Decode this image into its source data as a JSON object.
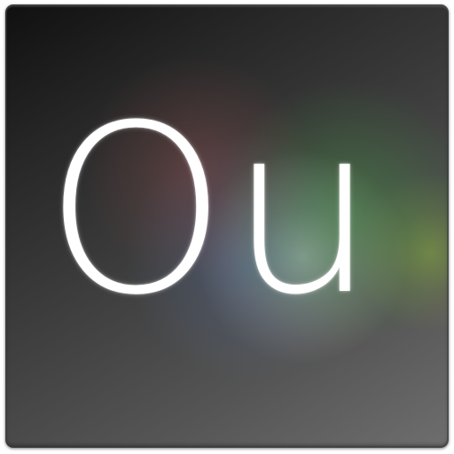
{
  "icon": {
    "label": "Ou"
  },
  "colors": {
    "letters": "#ffffff",
    "background_dark": "#101010",
    "background_light": "#6e6e6e",
    "glow_red": "#be5a5a",
    "glow_green": "#46aa46",
    "glow_blue": "#5a78af"
  }
}
